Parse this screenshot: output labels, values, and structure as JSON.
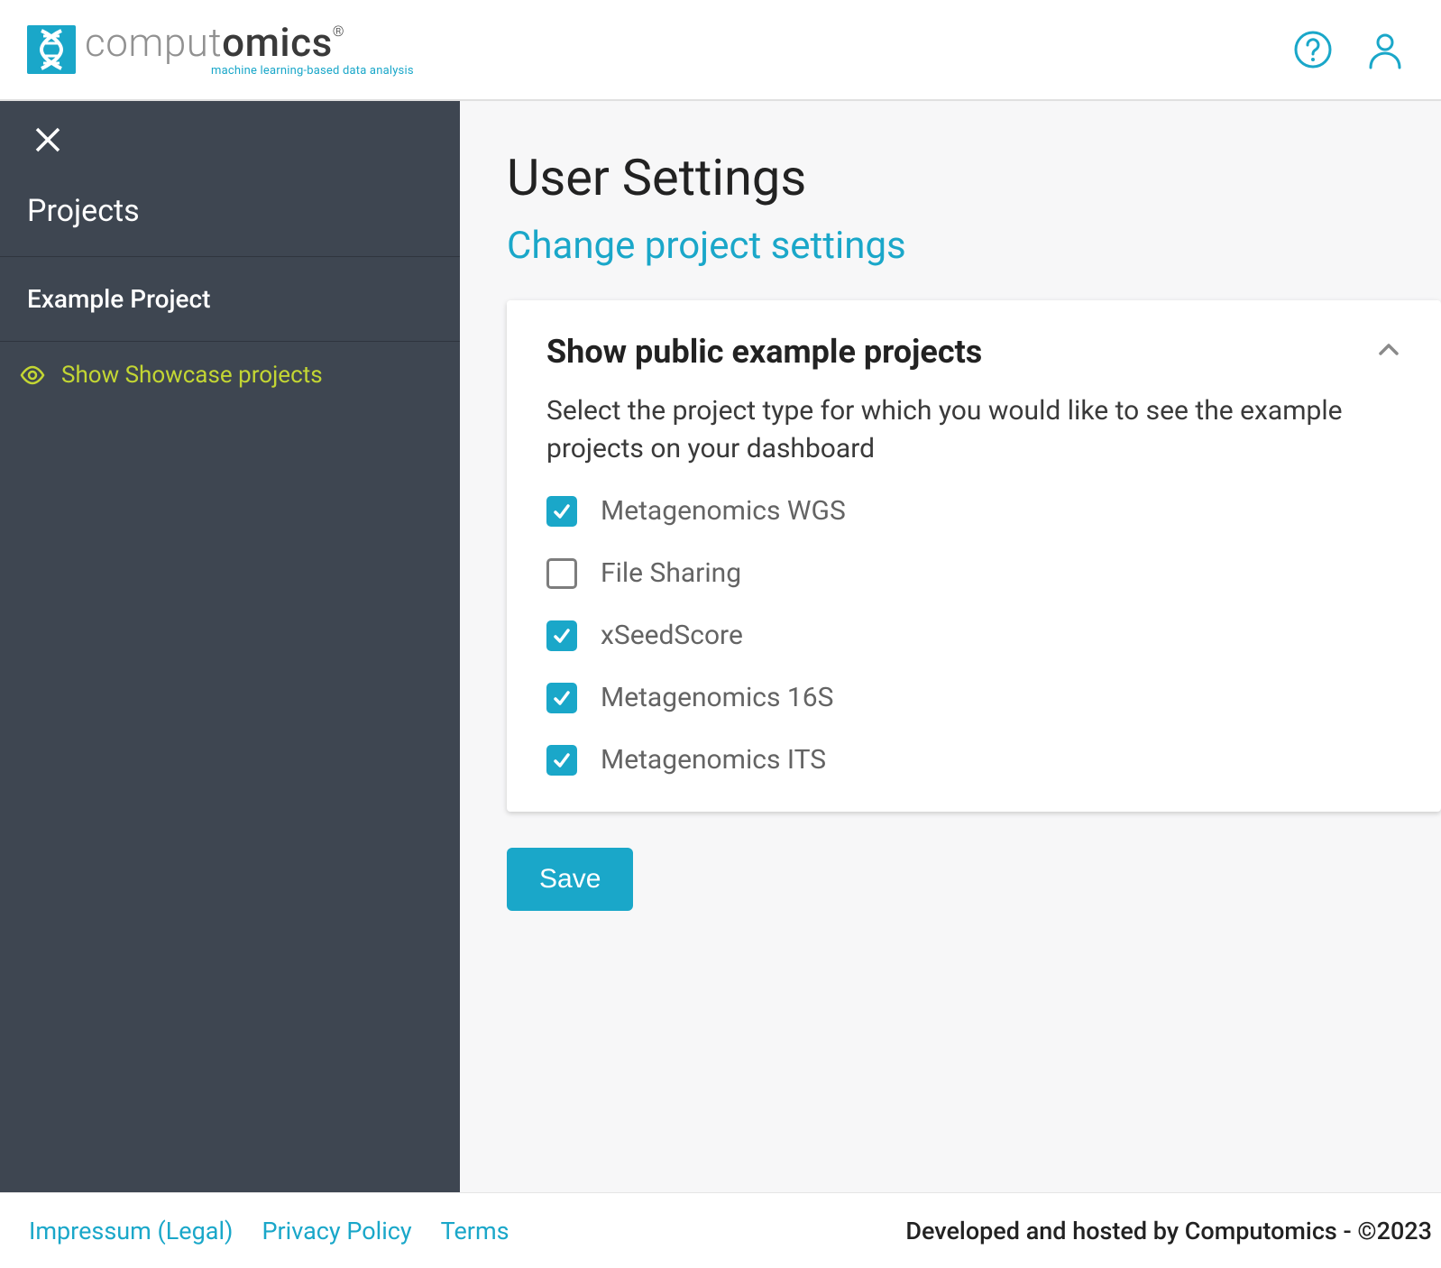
{
  "brand": {
    "name_light": "comput",
    "name_bold": "omics",
    "registered": "®",
    "tagline": "machine learning-based data analysis"
  },
  "sidebar": {
    "section_title": "Projects",
    "items": [
      {
        "label": "Example Project"
      }
    ],
    "showcase_link": "Show Showcase projects"
  },
  "page": {
    "title": "User Settings",
    "subtitle": "Change project settings"
  },
  "card": {
    "title": "Show public example projects",
    "description": "Select the project type for which you would like to see the example projects on your dashboard",
    "options": [
      {
        "label": "Metagenomics WGS",
        "checked": true
      },
      {
        "label": "File Sharing",
        "checked": false
      },
      {
        "label": "xSeedScore",
        "checked": true
      },
      {
        "label": "Metagenomics 16S",
        "checked": true
      },
      {
        "label": "Metagenomics ITS",
        "checked": true
      }
    ]
  },
  "actions": {
    "save": "Save"
  },
  "footer": {
    "links": [
      {
        "label": "Impressum (Legal)"
      },
      {
        "label": "Privacy Policy"
      },
      {
        "label": "Terms"
      }
    ],
    "right": "Developed and hosted by Computomics - ©2023"
  }
}
